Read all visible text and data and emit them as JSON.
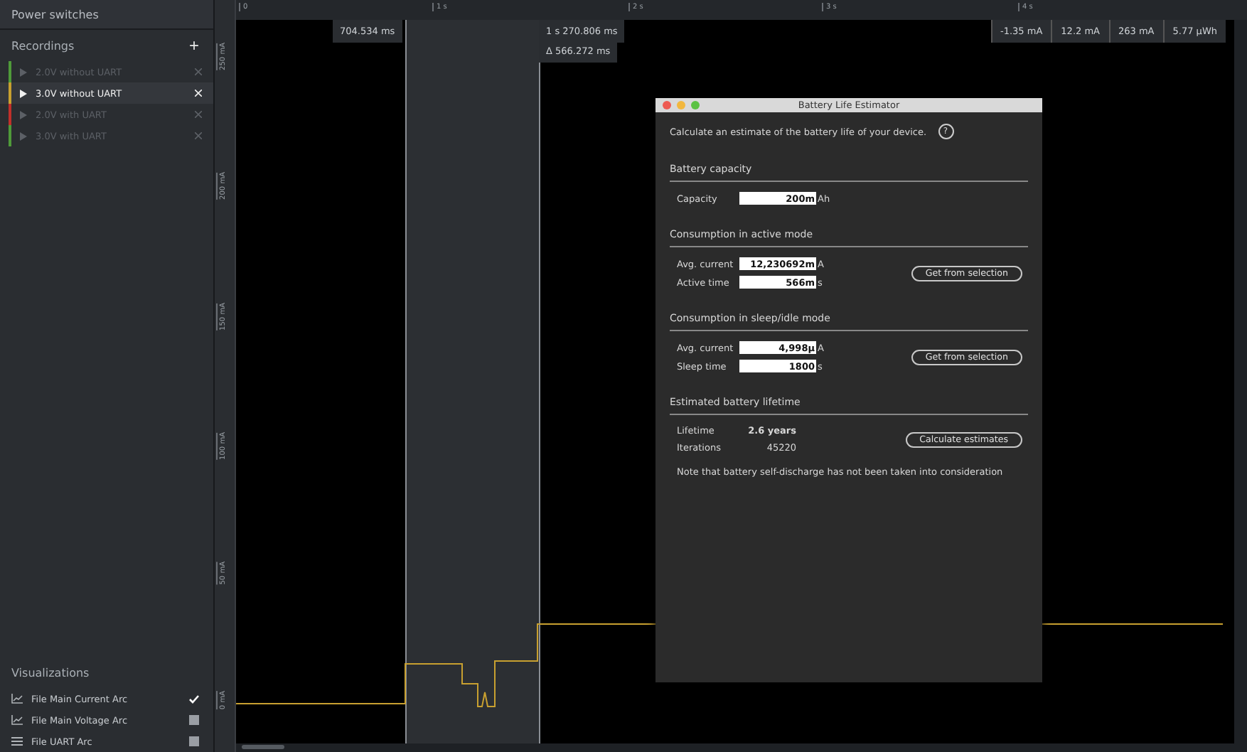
{
  "sidebar": {
    "power_switches": "Power switches",
    "recordings_title": "Recordings",
    "add_button": "+",
    "recordings": [
      {
        "label": "2.0V without UART",
        "selected": false,
        "color": "#4f9a3a"
      },
      {
        "label": "3.0V without UART",
        "selected": true,
        "color": "#c8a030"
      },
      {
        "label": "2.0V with UART",
        "selected": false,
        "color": "#c0302a"
      },
      {
        "label": "3.0V with UART",
        "selected": false,
        "color": "#4f9a3a"
      }
    ],
    "visualizations_title": "Visualizations",
    "visualizations": [
      {
        "label": "File Main Current Arc",
        "kind": "chart",
        "checked": true
      },
      {
        "label": "File Main Voltage Arc",
        "kind": "chart",
        "checked": false
      },
      {
        "label": "File UART Arc",
        "kind": "list",
        "checked": false
      }
    ]
  },
  "y_axis_labels": [
    "250 mA",
    "200 mA",
    "150 mA",
    "100 mA",
    "50 mA",
    "0 mA"
  ],
  "time_ticks": [
    "0",
    "1 s",
    "2 s",
    "3 s",
    "4 s"
  ],
  "cursors": {
    "start": "704.534 ms",
    "end": "1 s 270.806 ms",
    "delta": "Δ 566.272 ms"
  },
  "readouts": [
    "-1.35 mA",
    "12.2 mA",
    "263 mA",
    "5.77 µWh"
  ],
  "dialog": {
    "title": "Battery Life Estimator",
    "intro": "Calculate an estimate of the battery life of your device.",
    "help": "?",
    "sections": [
      {
        "title": "Battery capacity",
        "rows": [
          {
            "label": "Capacity",
            "value": "200m",
            "unit": "Ah"
          }
        ]
      },
      {
        "title": "Consumption in active mode",
        "rows": [
          {
            "label": "Avg. current",
            "value": "12,230692m",
            "unit": "A"
          },
          {
            "label": "Active time",
            "value": "566m",
            "unit": "s"
          }
        ],
        "button": "Get from selection"
      },
      {
        "title": "Consumption in sleep/idle mode",
        "rows": [
          {
            "label": "Avg. current",
            "value": "4,998µ",
            "unit": "A"
          },
          {
            "label": "Sleep time",
            "value": "1800",
            "unit": "s"
          }
        ],
        "button": "Get from selection"
      }
    ],
    "result": {
      "title": "Estimated battery lifetime",
      "lifetime_label": "Lifetime",
      "lifetime": "2.6 years",
      "iterations_label": "Iterations",
      "iterations": "45220",
      "button": "Calculate estimates",
      "note": "Note that battery self-discharge has not been taken into consideration"
    }
  }
}
